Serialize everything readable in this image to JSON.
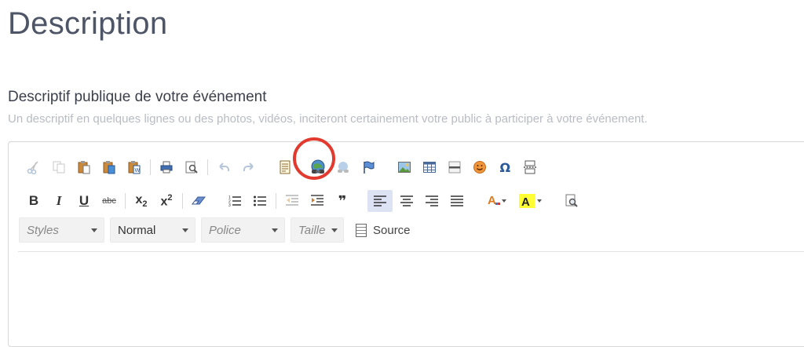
{
  "page": {
    "title": "Description",
    "field_label": "Descriptif publique de votre événement",
    "field_hint": "Un descriptif en quelques lignes ou des photos, vidéos, inciteront certainement votre public à participer à votre événement."
  },
  "toolbar": {
    "row1": [
      {
        "name": "cut",
        "icon": "scissors-icon",
        "enabled": false
      },
      {
        "name": "copy",
        "icon": "copy-icon",
        "enabled": false
      },
      {
        "name": "paste",
        "icon": "paste-icon",
        "enabled": true
      },
      {
        "name": "paste-text",
        "icon": "paste-text-icon",
        "enabled": true
      },
      {
        "name": "paste-word",
        "icon": "paste-word-icon",
        "enabled": true
      },
      {
        "name": "print",
        "icon": "printer-icon",
        "enabled": true
      },
      {
        "name": "preview",
        "icon": "preview-icon",
        "enabled": true
      },
      {
        "name": "undo",
        "icon": "undo-icon",
        "enabled": false
      },
      {
        "name": "redo",
        "icon": "redo-icon",
        "enabled": false
      },
      {
        "name": "templates",
        "icon": "template-icon",
        "enabled": true
      },
      {
        "name": "link",
        "icon": "globe-link-icon",
        "enabled": true,
        "highlighted": true
      },
      {
        "name": "unlink",
        "icon": "unlink-icon",
        "enabled": false
      },
      {
        "name": "anchor",
        "icon": "flag-icon",
        "enabled": true
      },
      {
        "name": "image",
        "icon": "image-icon",
        "enabled": true
      },
      {
        "name": "table",
        "icon": "table-icon",
        "enabled": true
      },
      {
        "name": "horizontal-rule",
        "icon": "hr-icon",
        "enabled": true
      },
      {
        "name": "smiley",
        "icon": "smiley-icon",
        "enabled": true
      },
      {
        "name": "special-char",
        "icon": "omega-icon",
        "enabled": true
      },
      {
        "name": "page-break",
        "icon": "page-break-icon",
        "enabled": true
      }
    ],
    "row2_format": {
      "bold": "B",
      "italic": "I",
      "underline": "U",
      "strike": "abc",
      "subscript": "x",
      "sub_mark": "2",
      "superscript": "x",
      "sup_mark": "2",
      "quote": "❞"
    },
    "combos": [
      {
        "name": "styles",
        "value": "Styles",
        "placeholder": true
      },
      {
        "name": "format",
        "value": "Normal",
        "placeholder": false
      },
      {
        "name": "font",
        "value": "Police",
        "placeholder": true
      },
      {
        "name": "size",
        "value": "Taille",
        "placeholder": true
      }
    ],
    "source_label": "Source"
  },
  "colors": {
    "accent": "#e23a2e",
    "title": "#4d5566",
    "hint": "#b9bcc4",
    "active_bg": "#dde3f4"
  }
}
